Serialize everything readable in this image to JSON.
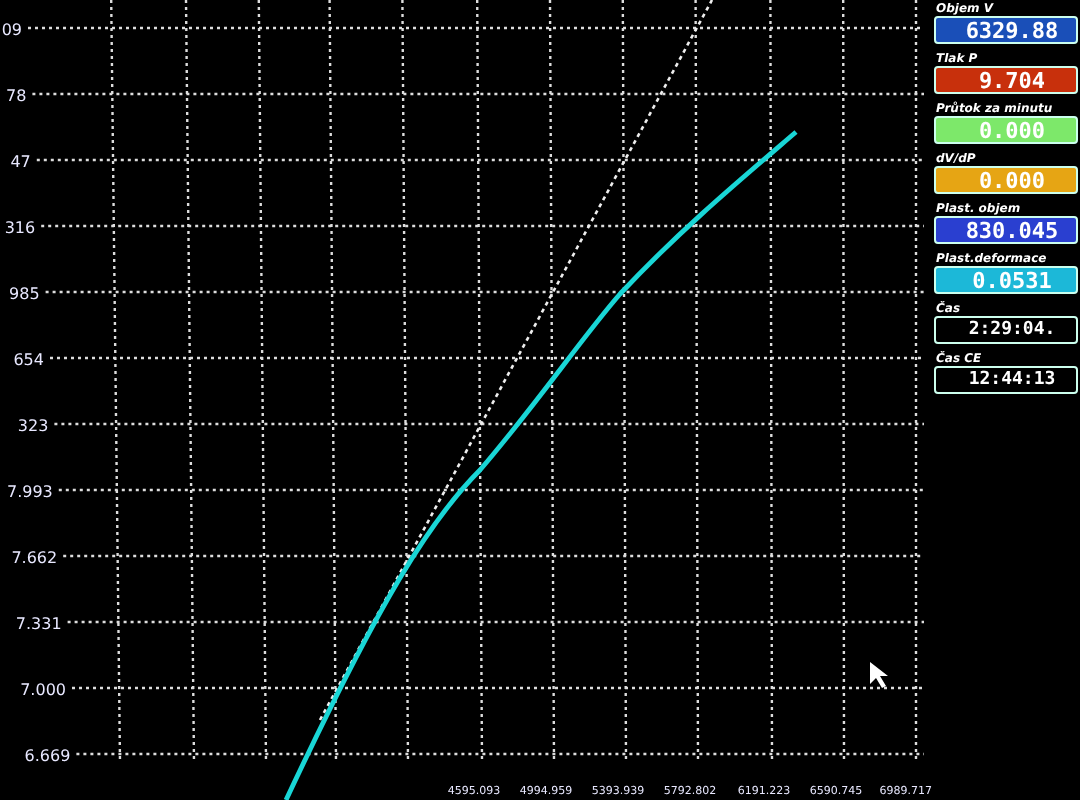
{
  "plot": {
    "y_ticks": [
      "09",
      "78",
      "47",
      "316",
      "985",
      "654",
      "323",
      "7.993",
      "7.662",
      "7.331",
      "7.000",
      "6.669"
    ],
    "x_ticks": [
      "4595.093",
      "4994.959",
      "5393.939",
      "5792.802",
      "6191.223",
      "6590.745",
      "6989.717"
    ]
  },
  "readouts": [
    {
      "label": "Objem V",
      "value": "6329.88",
      "color": "#1a4fb8"
    },
    {
      "label": "Tlak P",
      "value": "9.704",
      "color": "#c8300c"
    },
    {
      "label": "Průtok za minutu",
      "value": "0.000",
      "color": "#7de86a"
    },
    {
      "label": "dV/dP",
      "value": "0.000",
      "color": "#e6a514"
    },
    {
      "label": "Plast. objem",
      "value": "830.045",
      "color": "#2a3fd0"
    },
    {
      "label": "Plast.deformace",
      "value": "0.0531",
      "color": "#1cb8d8"
    },
    {
      "label": "Čas",
      "value": "2:29:04.",
      "color": "#000000"
    },
    {
      "label": "Čas CE",
      "value": "12:44:13",
      "color": "#000000"
    }
  ]
}
